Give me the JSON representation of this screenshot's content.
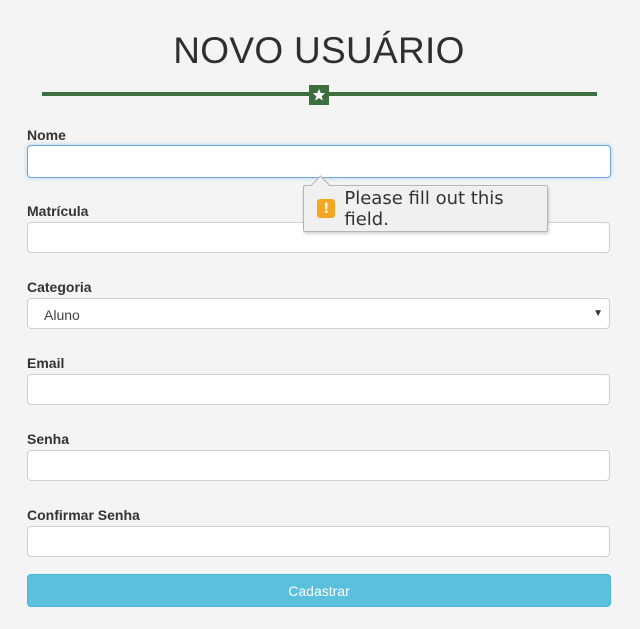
{
  "page": {
    "title": "NOVO USUÁRIO",
    "accent_color": "#3d6e3f",
    "divider_icon": "star-icon"
  },
  "form": {
    "nome": {
      "label": "Nome",
      "value": ""
    },
    "matricula": {
      "label": "Matrícula",
      "value": ""
    },
    "categoria": {
      "label": "Categoria",
      "selected": "Aluno"
    },
    "email": {
      "label": "Email",
      "value": ""
    },
    "senha": {
      "label": "Senha",
      "value": ""
    },
    "confirmar_senha": {
      "label": "Confirmar Senha",
      "value": ""
    },
    "submit_label": "Cadastrar",
    "submit_color": "#5bc0de"
  },
  "validation_tooltip": {
    "icon": "warning-icon",
    "icon_glyph": "!",
    "message": "Please fill out this field.",
    "icon_color": "#f5a623"
  }
}
